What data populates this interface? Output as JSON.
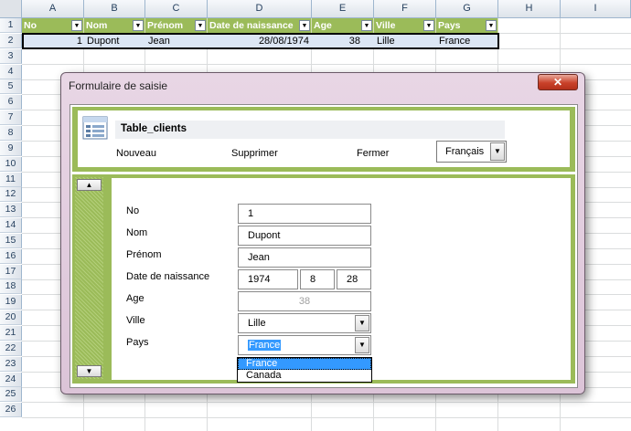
{
  "spreadsheet": {
    "columns": [
      "A",
      "B",
      "C",
      "D",
      "E",
      "F",
      "G",
      "H",
      "I"
    ],
    "rows": [
      "1",
      "2",
      "3",
      "4",
      "5",
      "6",
      "7",
      "8",
      "9",
      "10",
      "11",
      "12",
      "13",
      "14",
      "15",
      "16",
      "17",
      "18",
      "19",
      "20",
      "21",
      "22",
      "23",
      "24",
      "25",
      "26"
    ],
    "table_headers": [
      "No",
      "Nom",
      "Prénom",
      "Date de naissance",
      "Age",
      "Ville",
      "Pays"
    ],
    "filter_glyph": "▼",
    "row2": {
      "no": "1",
      "nom": "Dupont",
      "prenom": "Jean",
      "date": "28/08/1974",
      "age": "38",
      "ville": "Lille",
      "pays": "France"
    },
    "header_color": "#9bbb59",
    "selection_color": "#dce6f4"
  },
  "dialog": {
    "title": "Formulaire de saisie",
    "close_glyph": "✕",
    "table_name": "Table_clients",
    "actions": {
      "new": "Nouveau",
      "delete": "Supprimer",
      "close": "Fermer"
    },
    "language": {
      "value": "Français"
    },
    "scroll_up_glyph": "▲",
    "scroll_down_glyph": "▼",
    "dropdown_glyph": "▼",
    "fields": {
      "no": {
        "label": "No",
        "value": "1"
      },
      "nom": {
        "label": "Nom",
        "value": "Dupont"
      },
      "prenom": {
        "label": "Prénom",
        "value": "Jean"
      },
      "date": {
        "label": "Date de naissance",
        "year": "1974",
        "month": "8",
        "day": "28"
      },
      "age": {
        "label": "Age",
        "value": "38"
      },
      "ville": {
        "label": "Ville",
        "value": "Lille"
      },
      "pays": {
        "label": "Pays",
        "value": "France",
        "options": [
          "France",
          "Canada"
        ]
      }
    },
    "accent_color": "#9bbb59"
  }
}
